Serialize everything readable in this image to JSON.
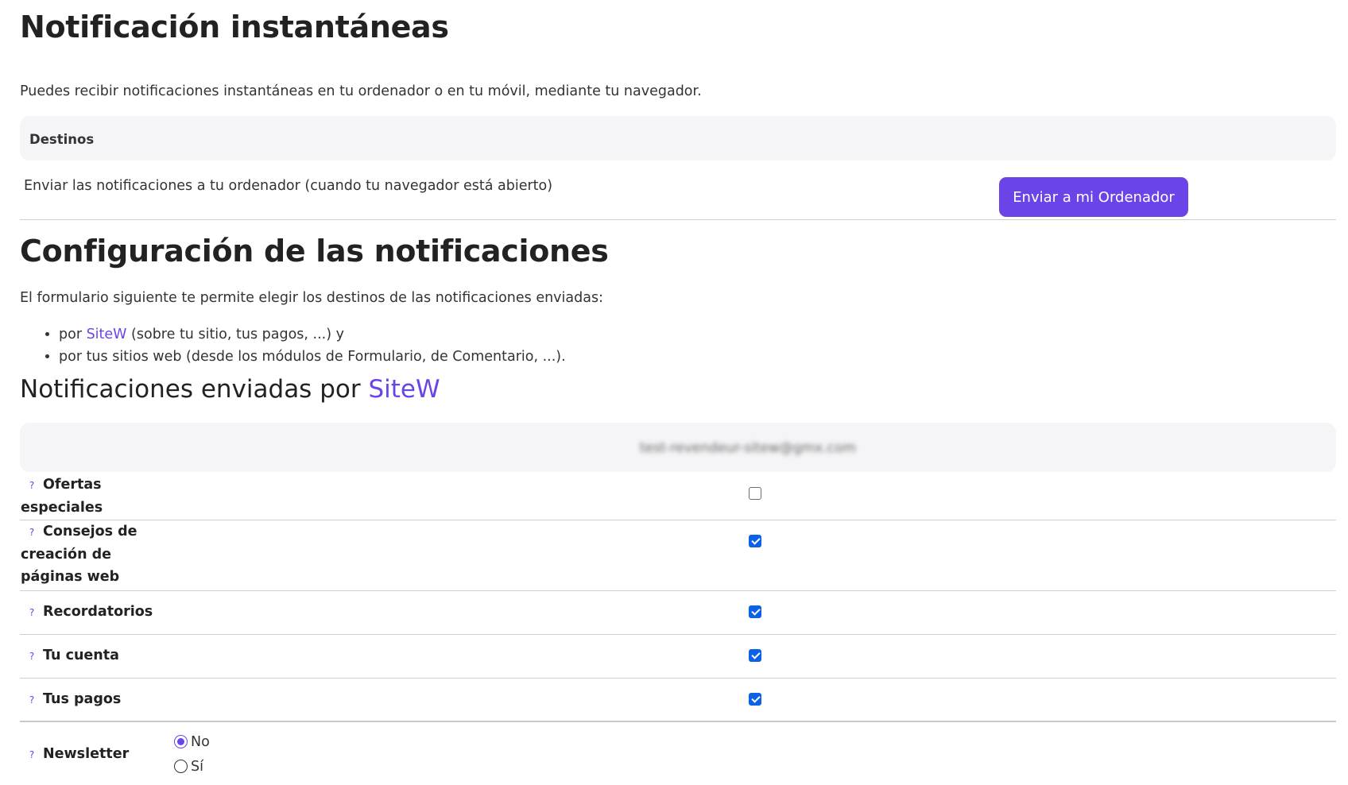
{
  "instant": {
    "title": "Notificación instantáneas",
    "description": "Puedes recibir notificaciones instantáneas en tu ordenador o en tu móvil, mediante tu navegador.",
    "destinations_header": "Destinos",
    "row_text": "Enviar las notificaciones a tu ordenador (cuando tu navegador está abierto)",
    "send_button": "Enviar a mi Ordenador"
  },
  "config": {
    "title": "Configuración de las notificaciones",
    "intro": "El formulario siguiente te permite elegir los destinos de las notificaciones enviadas:",
    "bullet1_prefix": "por ",
    "bullet1_link": "SiteW",
    "bullet1_suffix": " (sobre tu sitio, tus pagos, ...) y",
    "bullet2": "por tus sitios web (desde los módulos de Formulario, de Comentario, ...)."
  },
  "sitew_section": {
    "title_prefix": "Notificaciones enviadas por ",
    "title_link": "SiteW",
    "email_blurred": "test-revendeur-sitew@gmx.com",
    "help_glyph": "?",
    "rows": [
      {
        "label": "Ofertas especiales",
        "checked": false
      },
      {
        "label": "Consejos de creación de páginas web",
        "checked": true
      },
      {
        "label": "Recordatorios",
        "checked": true
      },
      {
        "label": "Tu cuenta",
        "checked": true
      },
      {
        "label": "Tus pagos",
        "checked": true
      }
    ],
    "newsletter": {
      "label": "Newsletter",
      "options": [
        "No",
        "Sí"
      ],
      "selected": "No"
    }
  },
  "colors": {
    "accent": "#6b44e8",
    "checkbox": "#0b62e4",
    "panel_bg": "#f5f5f7"
  }
}
